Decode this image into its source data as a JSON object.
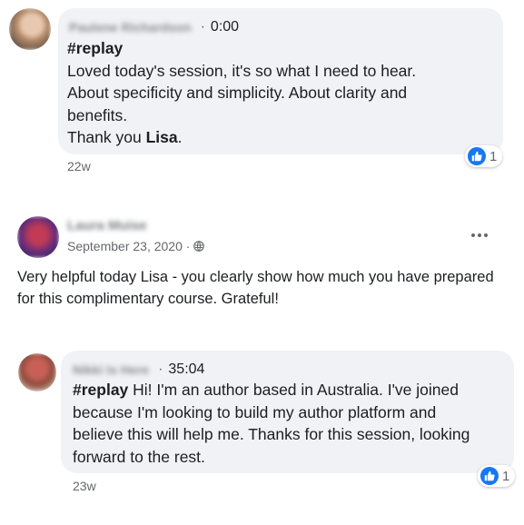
{
  "comment1": {
    "author": "Paulene Richardson",
    "timestamp": "0:00",
    "separator": "·",
    "hashtag": "#replay",
    "lines": [
      "Loved today's session, it's so what I need to hear.",
      "About specificity and simplicity. About clarity and",
      "benefits."
    ],
    "thanks_prefix": "Thank you ",
    "thanks_name": "Lisa",
    "thanks_suffix": ".",
    "reaction_count": "1",
    "age": "22w"
  },
  "post": {
    "author": "Laura Muise",
    "date": "September 23, 2020 ·",
    "body_lines": [
      "Very helpful today Lisa - you clearly show how much you have prepared",
      "for this complimentary course. Grateful!"
    ]
  },
  "comment2": {
    "author": "Nikki Is Here",
    "separator": "·",
    "timestamp": "35:04",
    "hashtag": "#replay",
    "first_line_rest": " Hi! I'm an author based in Australia. I've joined",
    "lines": [
      "because I'm looking to build my author platform and",
      "believe this will help me. Thanks for this session, looking",
      "forward to the rest."
    ],
    "reaction_count": "1",
    "age": "23w"
  },
  "colors": {
    "bubble": "#f0f2f5",
    "like_blue": "#1877f2",
    "secondary_text": "#65676b"
  },
  "icons": [
    "like-icon",
    "globe-icon",
    "more-options-icon"
  ]
}
